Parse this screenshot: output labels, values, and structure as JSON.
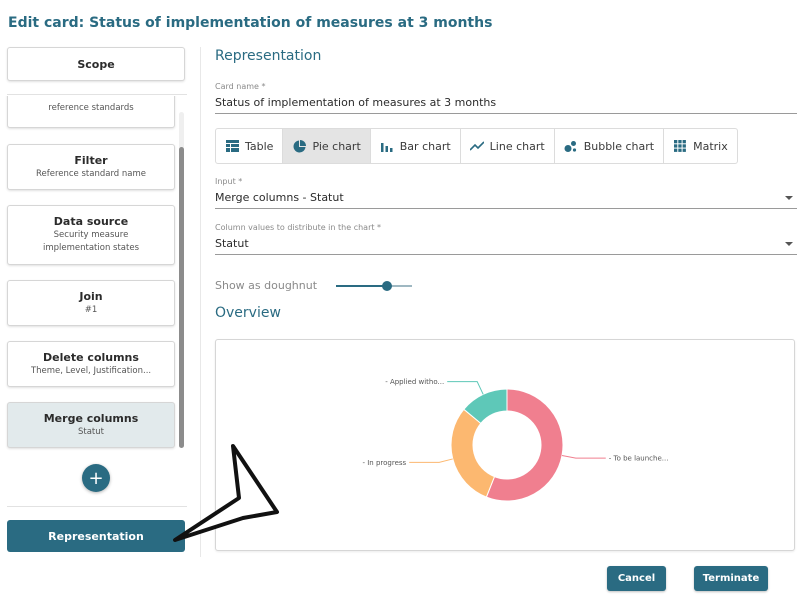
{
  "page": {
    "title": "Edit card: Status of implementation of measures at 3 months"
  },
  "sidebar": {
    "scope_label": "Scope",
    "steps": [
      {
        "title": "",
        "subtitle": "reference standards"
      },
      {
        "title": "Filter",
        "subtitle": "Reference standard name"
      },
      {
        "title": "Data source",
        "subtitle": "Security measure implementation states"
      },
      {
        "title": "Join",
        "subtitle": "#1"
      },
      {
        "title": "Delete columns",
        "subtitle": "Theme, Level, Justification..."
      },
      {
        "title": "Merge columns",
        "subtitle": "Statut",
        "selected": true
      }
    ],
    "add_step_symbol": "+",
    "representation_label": "Representation"
  },
  "main": {
    "representation_heading": "Representation",
    "card_name": {
      "label": "Card name *",
      "value": "Status of implementation of measures at 3 months"
    },
    "chart_tabs": [
      {
        "label": "Table",
        "icon": "table-icon",
        "active": false
      },
      {
        "label": "Pie chart",
        "icon": "pie-chart-icon",
        "active": true
      },
      {
        "label": "Bar chart",
        "icon": "bar-chart-icon",
        "active": false
      },
      {
        "label": "Line chart",
        "icon": "line-chart-icon",
        "active": false
      },
      {
        "label": "Bubble chart",
        "icon": "bubble-chart-icon",
        "active": false
      },
      {
        "label": "Matrix",
        "icon": "matrix-icon",
        "active": false
      }
    ],
    "input": {
      "label": "Input *",
      "value": "Merge columns - Statut"
    },
    "column_values": {
      "label": "Column values to distribute in the chart *",
      "value": "Statut"
    },
    "doughnut_toggle": {
      "label": "Show as doughnut",
      "enabled": true,
      "level": 0.65
    },
    "overview_heading": "Overview"
  },
  "chart_data": {
    "type": "pie",
    "doughnut": true,
    "title": "",
    "slices": [
      {
        "label": "To be launche...",
        "value": 56,
        "color": "#f07f8f"
      },
      {
        "label": "In progress",
        "value": 30,
        "color": "#fcb870"
      },
      {
        "label": "Applied witho...",
        "value": 14,
        "color": "#5ec8b8"
      }
    ]
  },
  "footer": {
    "cancel_label": "Cancel",
    "terminate_label": "Terminate"
  },
  "colors": {
    "accent": "#2a6b82",
    "selected_step": "#e2eaec"
  }
}
